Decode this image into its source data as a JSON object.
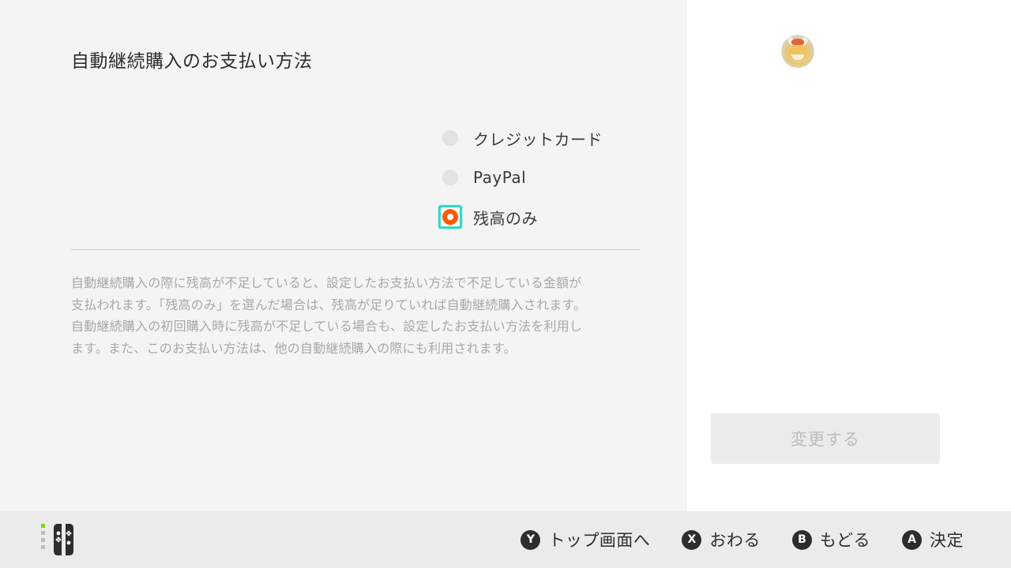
{
  "header": {
    "title": "自動継続購入のお支払い方法"
  },
  "payment_options": [
    {
      "label": "クレジットカード",
      "selected": false
    },
    {
      "label": "PayPal",
      "selected": false
    },
    {
      "label": "残高のみ",
      "selected": true
    }
  ],
  "description": {
    "lines": [
      "自動継続購入の際に残高が不足していると、設定したお支払い方法で不足している金額が",
      "支払われます。「残高のみ」を選んだ場合は、残高が足りていれば自動継続購入されます。",
      "自動継続購入の初回購入時に残高が不足している場合も、設定したお支払い方法を利用し",
      "ます。また、このお支払い方法は、他の自動継続購入の際にも利用されます。"
    ]
  },
  "side_panel": {
    "confirm_button_label": "変更する",
    "confirm_button_enabled": false
  },
  "footer": {
    "actions": [
      {
        "button": "Y",
        "label": "トップ画面へ"
      },
      {
        "button": "X",
        "label": "おわる"
      },
      {
        "button": "B",
        "label": "もどる"
      },
      {
        "button": "A",
        "label": "決定"
      }
    ]
  },
  "colors": {
    "selection_highlight": "#34d6c7",
    "radio_selected": "#ff5a00",
    "joycon_indicator": "#7ed321"
  }
}
